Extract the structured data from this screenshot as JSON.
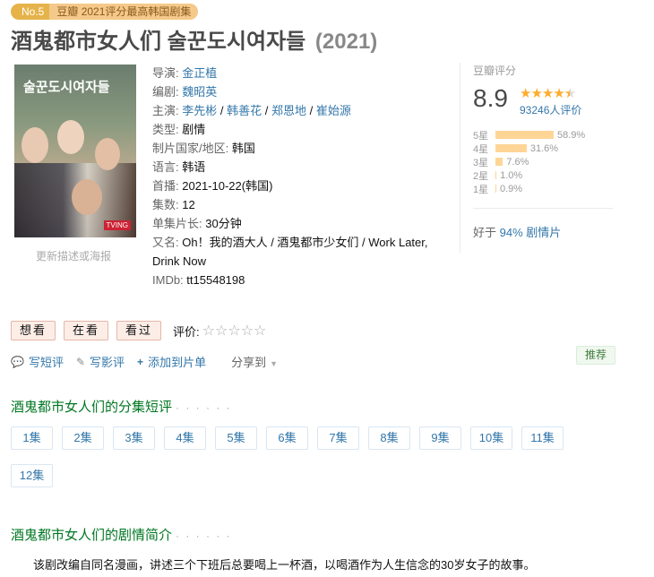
{
  "badge": {
    "rank": "No.5",
    "award": "豆瓣 2021评分最高韩国剧集"
  },
  "title": {
    "main": "酒鬼都市女人们 술꾼도시여자들",
    "year": "(2021)"
  },
  "poster": {
    "title": "술꾼도시여자들",
    "tag": "TVING",
    "link_label": "更新描述或海报"
  },
  "info": {
    "director_label": "导演:",
    "director": "金正植",
    "writer_label": "编剧:",
    "writer": "魏昭英",
    "cast_label": "主演:",
    "cast": [
      "李先彬",
      "韩善花",
      "郑恩地",
      "崔始源"
    ],
    "genre_label": "类型:",
    "genre": "剧情",
    "country_label": "制片国家/地区:",
    "country": "韩国",
    "language_label": "语言:",
    "language": "韩语",
    "premiere_label": "首播:",
    "premiere": "2021-10-22(韩国)",
    "episodes_label": "集数:",
    "episodes": "12",
    "runtime_label": "单集片长:",
    "runtime": "30分钟",
    "aka_label": "又名:",
    "aka": "Oh！我的酒大人 / 酒鬼都市少女们 / Work Later, Drink Now",
    "imdb_label": "IMDb:",
    "imdb": "tt15548198"
  },
  "rating": {
    "label": "豆瓣评分",
    "score": "8.9",
    "stars_value": 4.5,
    "count": "93246人评价",
    "distribution": [
      {
        "label": "5星",
        "percent": 58.9,
        "text": "58.9%"
      },
      {
        "label": "4星",
        "percent": 31.6,
        "text": "31.6%"
      },
      {
        "label": "3星",
        "percent": 7.6,
        "text": "7.6%"
      },
      {
        "label": "2星",
        "percent": 1.0,
        "text": "1.0%"
      },
      {
        "label": "1星",
        "percent": 0.9,
        "text": "0.9%"
      }
    ],
    "better_prefix": "好于",
    "better_link": "94% 剧情片"
  },
  "actions": {
    "want": "想看",
    "watching": "在看",
    "watched": "看过",
    "rate_label": "评价:",
    "rate_stars": "☆☆☆☆☆"
  },
  "tools": {
    "short_review": "写短评",
    "long_review": "写影评",
    "add_list": "添加到片单",
    "share": "分享到",
    "recommend": "推荐"
  },
  "episodes_section": {
    "title": "酒鬼都市女人们的分集短评",
    "dots": "· · · · · ·",
    "items": [
      "1集",
      "2集",
      "3集",
      "4集",
      "5集",
      "6集",
      "7集",
      "8集",
      "9集",
      "10集",
      "11集",
      "12集"
    ]
  },
  "summary_section": {
    "title": "酒鬼都市女人们的剧情简介",
    "dots": "· · · · · ·",
    "text": "该剧改编自同名漫画，讲述三个下班后总要喝上一杯酒，以喝酒作为人生信念的30岁女子的故事。"
  },
  "colors": {
    "link": "#3377aa",
    "section": "#007722",
    "star": "#ffac2d",
    "bar": "#ffd596"
  }
}
